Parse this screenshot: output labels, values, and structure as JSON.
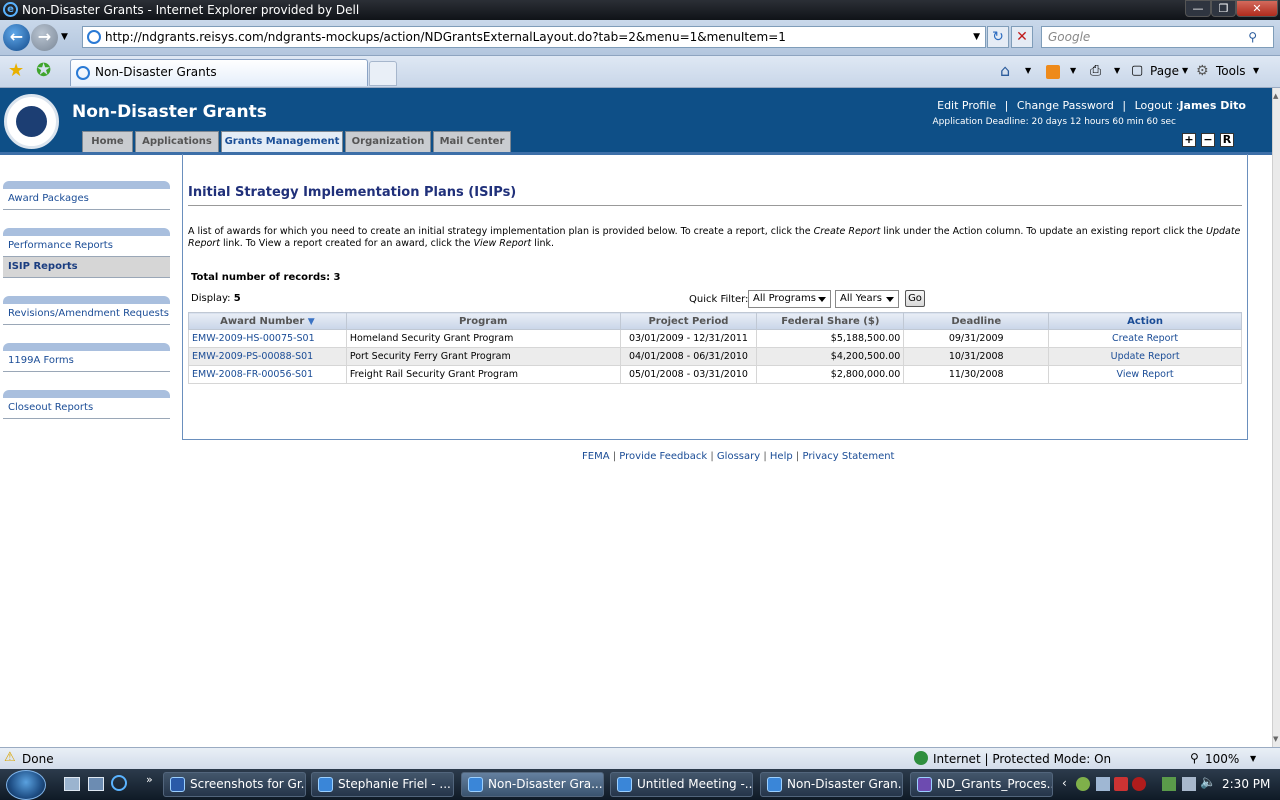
{
  "browser": {
    "title": "Non-Disaster Grants - Internet Explorer provided by Dell",
    "url": "http://ndgrants.reisys.com/ndgrants-mockups/action/NDGrantsExternalLayout.do?tab=2&menu=1&menuItem=1",
    "search_placeholder": "Google",
    "tab_label": "Non-Disaster Grants",
    "cmd_page": "Page",
    "cmd_tools": "Tools",
    "status_text": "Done",
    "zone_text": "Internet | Protected Mode: On",
    "zoom": "100%"
  },
  "header": {
    "app_name": "Non-Disaster Grants",
    "edit_profile": "Edit Profile",
    "change_password": "Change Password",
    "logout_prefix": "Logout :",
    "user_name": "James Dito",
    "deadline": "Application Deadline: 20 days 12 hours 60 min 60 sec",
    "tabs": [
      "Home",
      "Applications",
      "Grants Management",
      "Organization",
      "Mail Center"
    ],
    "small_buttons": [
      "+",
      "−",
      "R"
    ]
  },
  "sidebar": {
    "items": [
      "Award Packages",
      "Performance Reports",
      "ISIP Reports",
      "Revisions/Amendment Requests",
      "1199A Forms",
      "Closeout Reports"
    ]
  },
  "main": {
    "heading": "Initial Strategy Implementation Plans (ISIPs)",
    "desc_1": "A list of awards for which you need to create an initial strategy implementation plan is provided below. To create a report, click the ",
    "desc_create": "Create Report",
    "desc_2": " link under the Action column. To update an existing report click the ",
    "desc_update": "Update Report",
    "desc_3": " link. To View a report created for an award, click the ",
    "desc_view": "View Report",
    "desc_4": " link.",
    "total_label": "Total number of records: 3",
    "display_label": "Display: ",
    "display_value": "5",
    "quick_filter": "Quick Filter:",
    "filter_programs": "All Programs",
    "filter_years": "All Years",
    "go": "Go",
    "columns": [
      "Award Number",
      "Program",
      "Project Period",
      "Federal Share ($)",
      "Deadline",
      "Action"
    ],
    "rows": [
      [
        "EMW-2009-HS-00075-S01",
        "Homeland Security Grant Program",
        "03/01/2009 - 12/31/2011",
        "$5,188,500.00",
        "09/31/2009",
        "Create Report"
      ],
      [
        "EMW-2009-PS-00088-S01",
        "Port Security Ferry Grant Program",
        "04/01/2008 - 06/31/2010",
        "$4,200,500.00",
        "10/31/2008",
        "Update Report"
      ],
      [
        "EMW-2008-FR-00056-S01",
        "Freight Rail Security Grant Program",
        "05/01/2008 - 03/31/2010",
        "$2,800,000.00",
        "11/30/2008",
        "View Report"
      ]
    ]
  },
  "footer": {
    "links": [
      "FEMA",
      "Provide Feedback",
      "Glossary",
      "Help",
      "Privacy Statement"
    ]
  },
  "taskbar": {
    "items": [
      "Screenshots for Gr...",
      "Stephanie Friel - ...",
      "Non-Disaster Gra...",
      "Untitled Meeting -...",
      "Non-Disaster Gran...",
      "ND_Grants_Proces..."
    ],
    "clock": "2:30 PM"
  }
}
